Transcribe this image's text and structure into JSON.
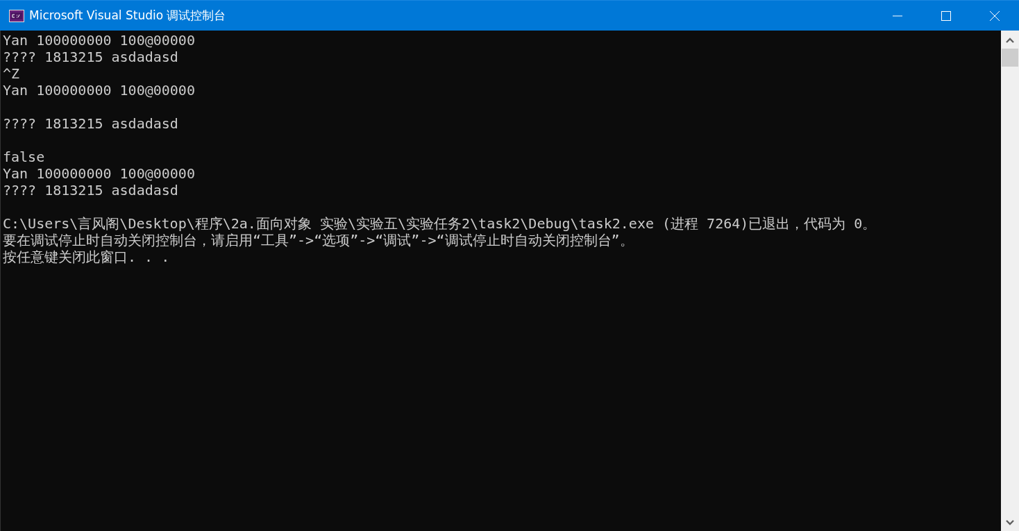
{
  "window": {
    "title": "Microsoft Visual Studio 调试控制台"
  },
  "console": {
    "blocks": [
      [
        "Yan 100000000 100@00000",
        "???? 1813215 asdadasd",
        "^Z",
        "Yan 100000000 100@00000"
      ],
      [
        "???? 1813215 asdadasd"
      ],
      [
        "false",
        "Yan 100000000 100@00000",
        "???? 1813215 asdadasd"
      ],
      [
        "C:\\Users\\言风阁\\Desktop\\程序\\2a.面向对象 实验\\实验五\\实验任务2\\task2\\Debug\\task2.exe (进程 7264)已退出，代码为 0。",
        "要在调试停止时自动关闭控制台，请启用“工具”->“选项”->“调试”->“调试停止时自动关闭控制台”。",
        "按任意键关闭此窗口. . ."
      ]
    ]
  }
}
